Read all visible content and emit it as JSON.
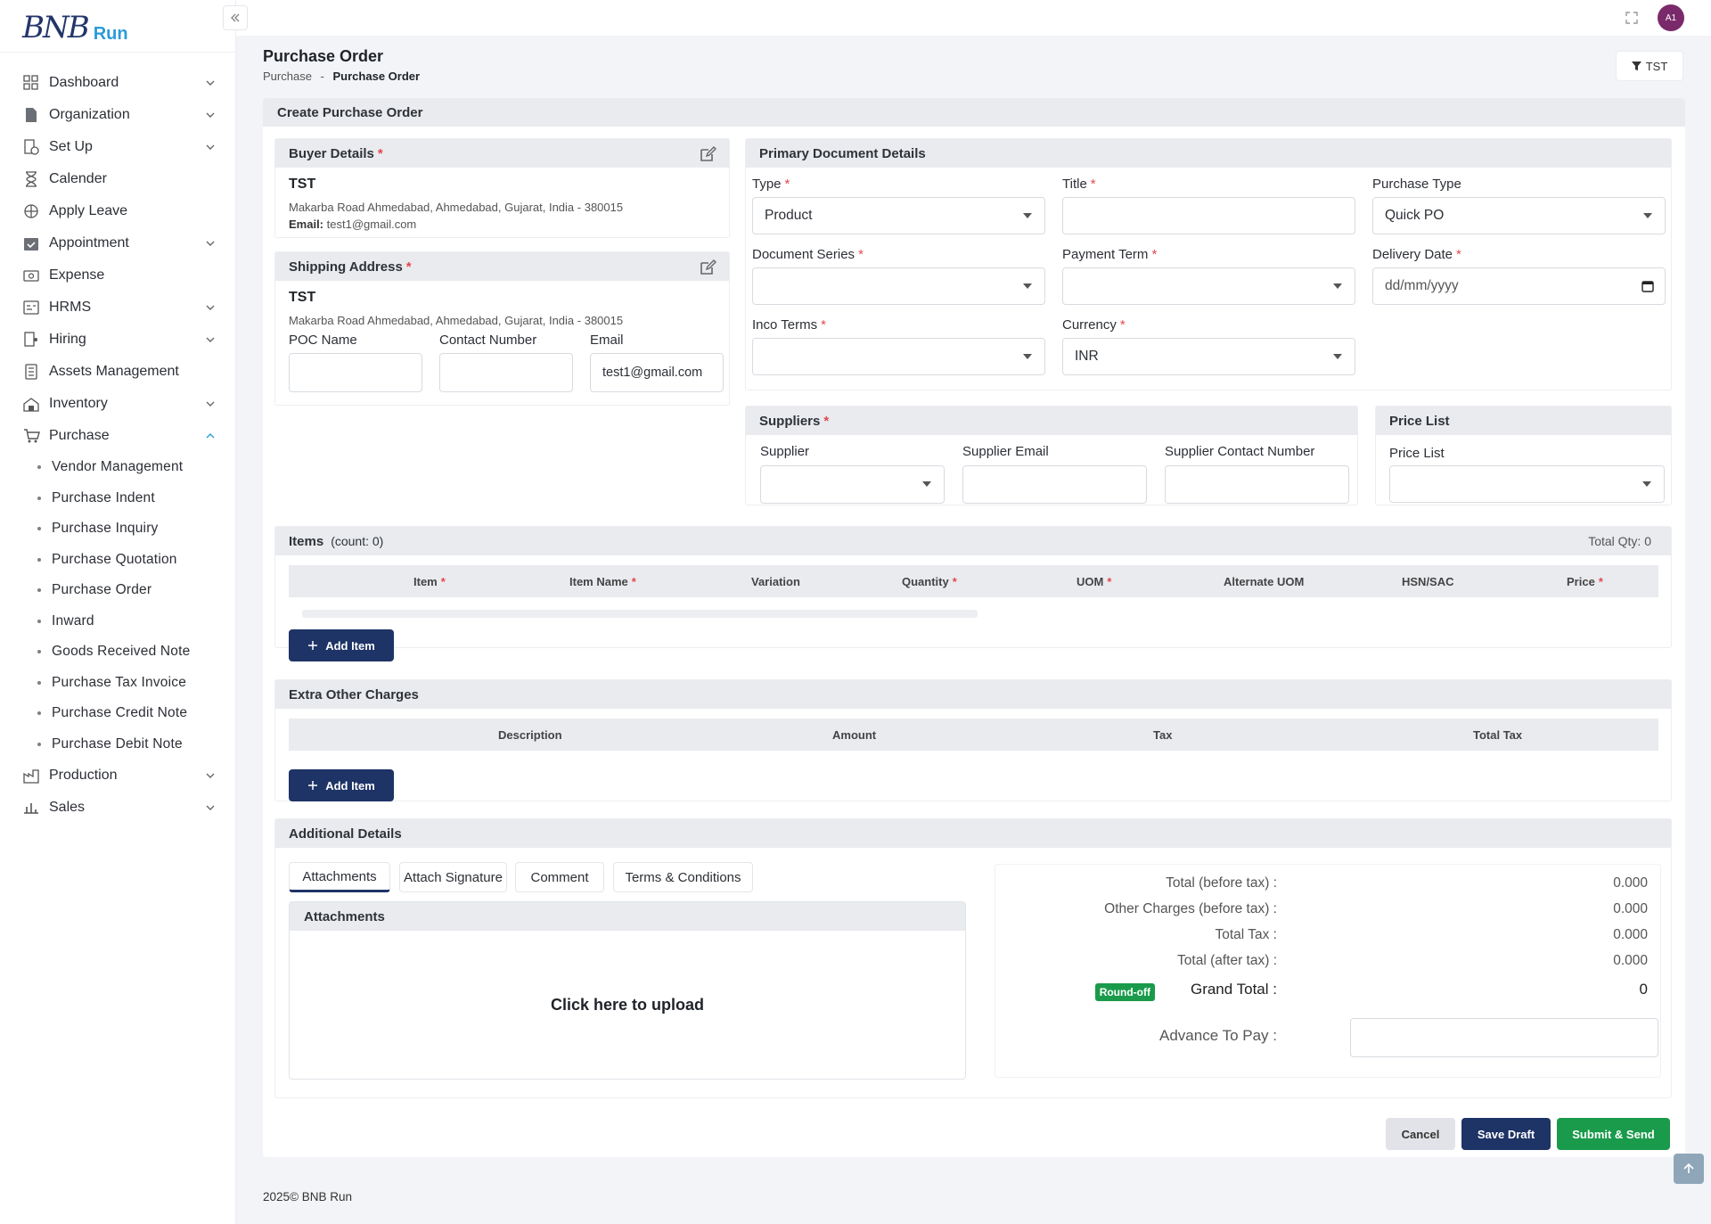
{
  "brand": {
    "logo_text": "BNB",
    "logo_suffix": "Run"
  },
  "topbar": {
    "avatar_initials": "A1"
  },
  "sidebar": {
    "items": [
      {
        "label": "Dashboard",
        "icon": "dashboard-icon",
        "chevron": "down"
      },
      {
        "label": "Organization",
        "icon": "document-icon",
        "chevron": "down"
      },
      {
        "label": "Set Up",
        "icon": "setup-icon",
        "chevron": "down"
      },
      {
        "label": "Calender",
        "icon": "hourglass-icon",
        "chevron": ""
      },
      {
        "label": "Apply Leave",
        "icon": "leave-icon",
        "chevron": ""
      },
      {
        "label": "Appointment",
        "icon": "calendar-check-icon",
        "chevron": "down"
      },
      {
        "label": "Expense",
        "icon": "expense-icon",
        "chevron": ""
      },
      {
        "label": "HRMS",
        "icon": "hrms-icon",
        "chevron": "down"
      },
      {
        "label": "Hiring",
        "icon": "hiring-icon",
        "chevron": "down"
      },
      {
        "label": "Assets Management",
        "icon": "assets-icon",
        "chevron": ""
      },
      {
        "label": "Inventory",
        "icon": "inventory-icon",
        "chevron": "down"
      },
      {
        "label": "Purchase",
        "icon": "cart-icon",
        "chevron": "up"
      }
    ],
    "purchase_sub": [
      "Vendor Management",
      "Purchase Indent",
      "Purchase Inquiry",
      "Purchase Quotation",
      "Purchase Order",
      "Inward",
      "Goods Received Note",
      "Purchase Tax Invoice",
      "Purchase Credit Note",
      "Purchase Debit Note"
    ],
    "items_after": [
      {
        "label": "Production",
        "icon": "factory-icon",
        "chevron": "down"
      },
      {
        "label": "Sales",
        "icon": "sales-icon",
        "chevron": "down"
      }
    ]
  },
  "page": {
    "title": "Purchase Order",
    "breadcrumb_parent": "Purchase",
    "breadcrumb_sep": "-",
    "breadcrumb_current": "Purchase Order",
    "filter_label": "TST"
  },
  "form": {
    "header": "Create Purchase Order",
    "buyer": {
      "title": "Buyer Details",
      "name": "TST",
      "address": "Makarba Road Ahmedabad, Ahmedabad, Gujarat, India - 380015",
      "email_label": "Email:",
      "email": "test1@gmail.com"
    },
    "shipping": {
      "title": "Shipping Address",
      "name": "TST",
      "address": "Makarba Road Ahmedabad, Ahmedabad, Gujarat, India - 380015",
      "poc_label": "POC Name",
      "contact_label": "Contact Number",
      "email_label": "Email",
      "email_value": "test1@gmail.com"
    },
    "primary": {
      "title": "Primary Document Details",
      "type_label": "Type",
      "type_value": "Product",
      "title_label": "Title",
      "title_value": "",
      "purchase_type_label": "Purchase Type",
      "purchase_type_value": "Quick PO",
      "doc_series_label": "Document Series",
      "payment_term_label": "Payment Term",
      "delivery_date_label": "Delivery Date",
      "delivery_date_placeholder": "dd/mm/yyyy",
      "inco_terms_label": "Inco Terms",
      "currency_label": "Currency",
      "currency_value": "INR"
    },
    "suppliers": {
      "title": "Suppliers",
      "supplier_label": "Supplier",
      "email_label": "Supplier Email",
      "contact_label": "Supplier Contact Number"
    },
    "price_list": {
      "title": "Price List",
      "label": "Price List"
    },
    "items": {
      "title": "Items",
      "count": "(count: 0)",
      "total_qty": "Total Qty: 0",
      "columns": [
        "Item",
        "Item Name",
        "Variation",
        "Quantity",
        "UOM",
        "Alternate UOM",
        "HSN/SAC",
        "Price"
      ],
      "add_label": "Add Item"
    },
    "extra": {
      "title": "Extra Other Charges",
      "columns": [
        "Description",
        "Amount",
        "Tax",
        "Total Tax"
      ],
      "add_label": "Add Item"
    },
    "additional": {
      "title": "Additional Details",
      "tabs": [
        "Attachments",
        "Attach Signature",
        "Comment",
        "Terms & Conditions"
      ],
      "attachments_title": "Attachments",
      "upload_text": "Click here to upload"
    },
    "totals": {
      "rows": [
        {
          "label": "Total (before tax) :",
          "value": "0.000"
        },
        {
          "label": "Other Charges (before tax) :",
          "value": "0.000"
        },
        {
          "label": "Total Tax :",
          "value": "0.000"
        },
        {
          "label": "Total (after tax) :",
          "value": "0.000"
        }
      ],
      "roundoff": "Round-off",
      "grand_label": "Grand Total :",
      "grand_value": "0",
      "advance_label": "Advance To Pay :"
    },
    "actions": {
      "cancel": "Cancel",
      "save_draft": "Save Draft",
      "submit": "Submit & Send"
    }
  },
  "footer": {
    "text": "2025© BNB Run"
  },
  "colors": {
    "primary": "#1e3366",
    "success": "#1a9b4b",
    "required": "#e5484d",
    "accent": "#2b9bd6"
  }
}
